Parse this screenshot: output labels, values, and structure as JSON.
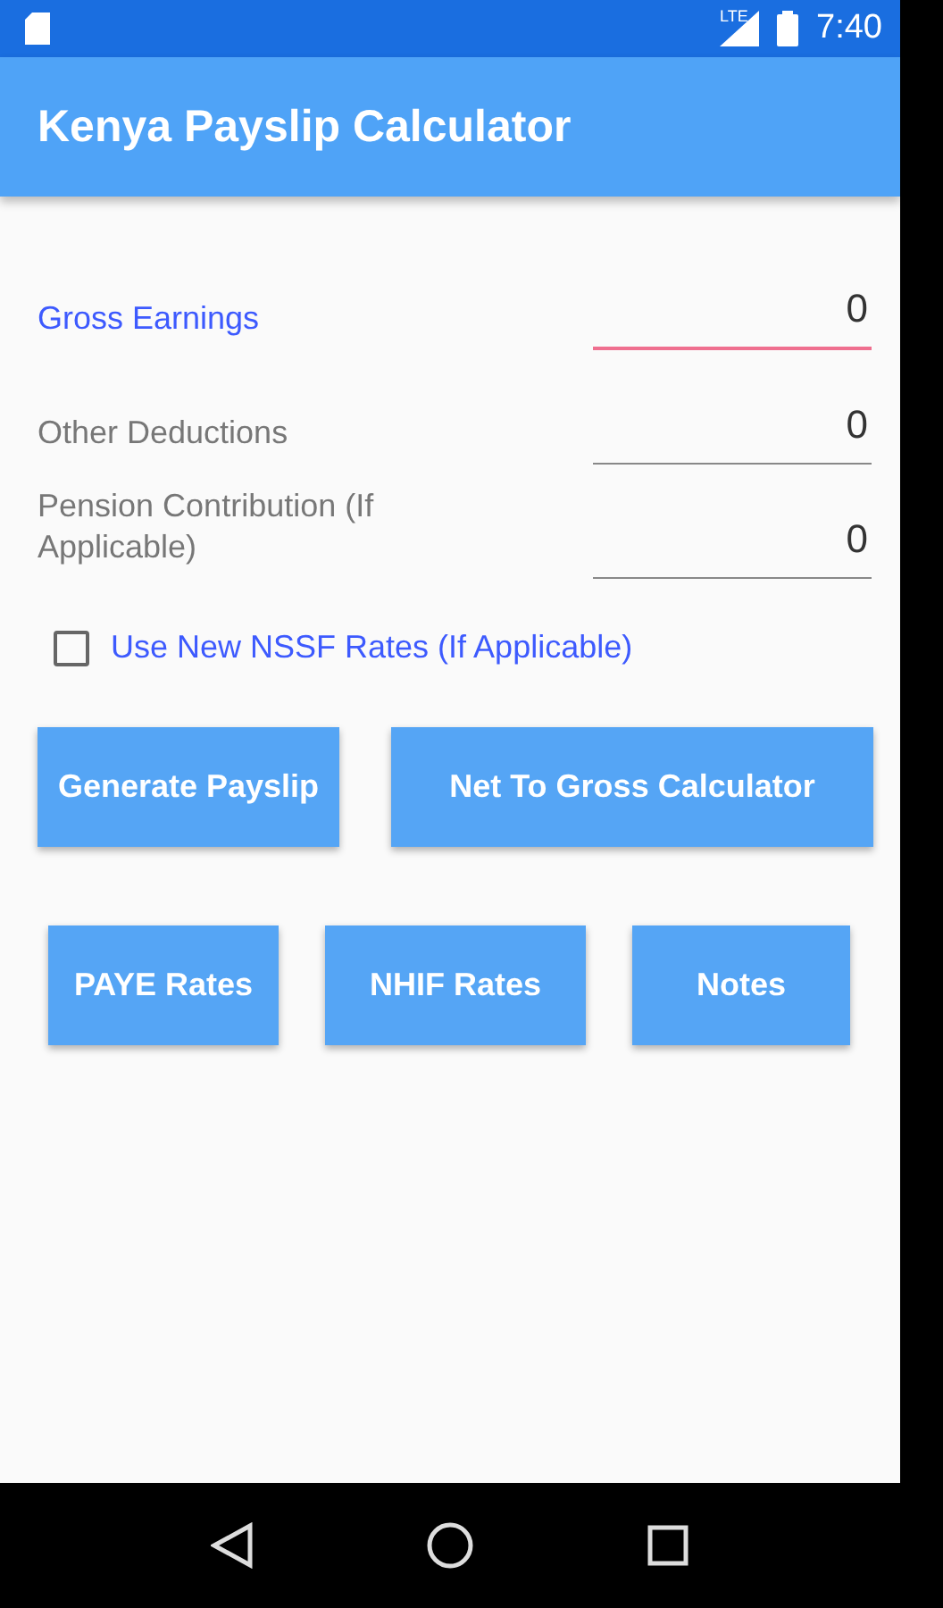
{
  "status_bar": {
    "network": "LTE",
    "time": "7:40"
  },
  "app_bar": {
    "title": "Kenya Payslip Calculator"
  },
  "fields": [
    {
      "label": "Gross Earnings",
      "value": "0",
      "focused": true
    },
    {
      "label": "Other Deductions",
      "value": "0",
      "focused": false
    },
    {
      "label": "Pension Contribution (If Applicable)",
      "value": "0",
      "focused": false
    }
  ],
  "checkbox": {
    "label": "Use New NSSF Rates (If Applicable)",
    "checked": false
  },
  "button_rows": [
    [
      "Generate Payslip",
      "Net To Gross Calculator"
    ],
    [
      "PAYE Rates",
      "NHIF Rates",
      "Notes"
    ]
  ]
}
